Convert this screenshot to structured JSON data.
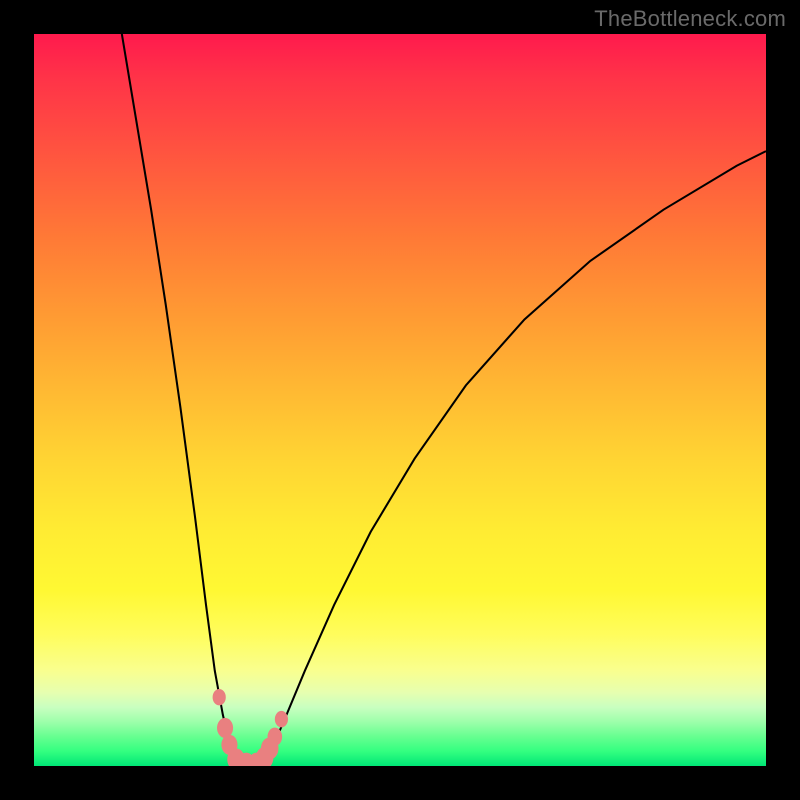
{
  "attribution": "TheBottleneck.com",
  "colors": {
    "frame": "#000000",
    "gradient_top": "#ff1a4d",
    "gradient_mid": "#ffd433",
    "gradient_bottom": "#00e676",
    "curve": "#000000",
    "marker": "#e98080"
  },
  "chart_data": {
    "type": "line",
    "title": "",
    "xlabel": "",
    "ylabel": "",
    "xlim": [
      0,
      100
    ],
    "ylim": [
      0,
      100
    ],
    "series": [
      {
        "name": "left-branch",
        "x": [
          12,
          14,
          16,
          18,
          20,
          22,
          23.5,
          24.7,
          25.8,
          26.6,
          27.2,
          27.8
        ],
        "y": [
          100,
          88,
          76,
          63,
          49,
          34,
          22,
          13,
          7,
          3.5,
          1.5,
          0.6
        ]
      },
      {
        "name": "right-branch",
        "x": [
          31.2,
          32,
          33,
          34.5,
          37,
          41,
          46,
          52,
          59,
          67,
          76,
          86,
          96,
          100
        ],
        "y": [
          0.6,
          1.5,
          3.5,
          7,
          13,
          22,
          32,
          42,
          52,
          61,
          69,
          76,
          82,
          84
        ]
      }
    ],
    "floor": {
      "name": "valley-floor",
      "x": [
        27.8,
        31.2
      ],
      "y": [
        0.6,
        0.6
      ]
    },
    "markers": [
      {
        "x": 25.3,
        "y": 9.4,
        "r": 0.9
      },
      {
        "x": 26.1,
        "y": 5.2,
        "r": 1.1
      },
      {
        "x": 26.7,
        "y": 2.9,
        "r": 1.1
      },
      {
        "x": 27.6,
        "y": 0.9,
        "r": 1.2
      },
      {
        "x": 29.0,
        "y": 0.45,
        "r": 1.1
      },
      {
        "x": 30.4,
        "y": 0.45,
        "r": 1.1
      },
      {
        "x": 31.5,
        "y": 1.1,
        "r": 1.2
      },
      {
        "x": 32.2,
        "y": 2.4,
        "r": 1.2
      },
      {
        "x": 32.9,
        "y": 4.0,
        "r": 1.0
      },
      {
        "x": 33.8,
        "y": 6.4,
        "r": 0.9
      }
    ]
  }
}
